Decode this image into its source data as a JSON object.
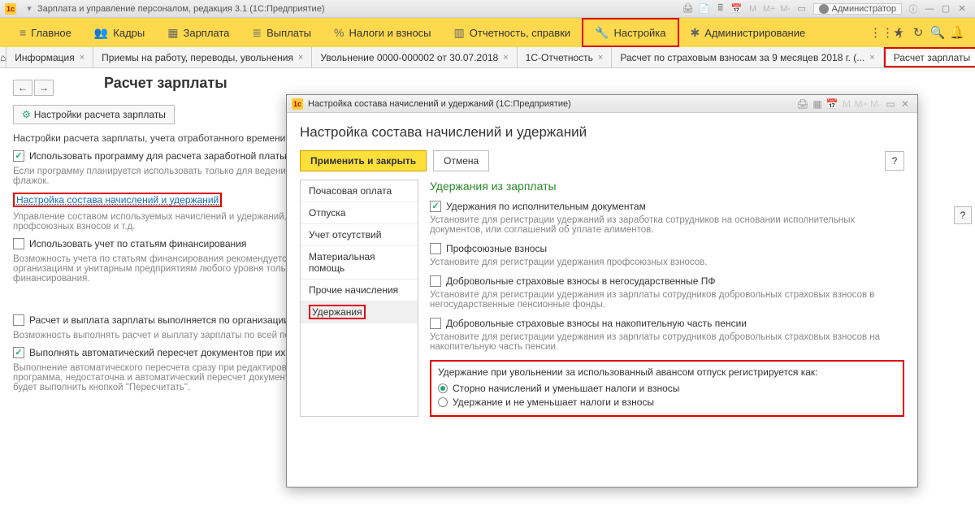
{
  "app_title": "Зарплата и управление персоналом, редакция 3.1  (1С:Предприятие)",
  "admin_user": "Администратор",
  "menu": {
    "items": [
      {
        "icon": "≡",
        "label": "Главное"
      },
      {
        "icon": "👥",
        "label": "Кадры"
      },
      {
        "icon": "▦",
        "label": "Зарплата"
      },
      {
        "icon": "≣",
        "label": "Выплаты"
      },
      {
        "icon": "%",
        "label": "Налоги и взносы"
      },
      {
        "icon": "▥",
        "label": "Отчетность, справки"
      },
      {
        "icon": "🔧",
        "label": "Настройка"
      },
      {
        "icon": "✱",
        "label": "Администрирование"
      }
    ]
  },
  "tabs": [
    {
      "label": "Информация"
    },
    {
      "label": "Приемы на работу, переводы, увольнения"
    },
    {
      "label": "Увольнение 0000-000002 от 30.07.2018"
    },
    {
      "label": "1С-Отчетность"
    },
    {
      "label": "Расчет по страховым взносам за 9 месяцев 2018 г. (..."
    },
    {
      "label": "Расчет зарплаты"
    }
  ],
  "page": {
    "title": "Расчет зарплаты",
    "settings_btn": "Настройки расчета зарплаты",
    "desc1": "Настройки расчета зарплаты, учета отработанного времени,",
    "chk_use_program": "Использовать программу для расчета заработной платы",
    "hint_use_program": "Если программу планируется использовать только для веде­ния предприятия, снимите этот флажок.",
    "link_setup": "Настройка состава начислений и удержаний",
    "hint_link": "Управление составом используемых начислений и удержан­ий, командировок, удержание профсоюзных взносов и т.д.",
    "chk_finance": "Использовать учет по статьям финансирования",
    "hint_finance": "Возможность учета по статьям финансирования рекомендуется использовать некоммерческим организациям и унитарным предприятиям любого уровня только при наличии целевого финансирования.",
    "chk_org": "Расчет и выплата зарплаты выполняется по организации",
    "hint_org": "Возможность выполнять расчет и выплату зарплаты по всей подразделениям.",
    "chk_auto": "Выполнять автоматический пересчет документов при их",
    "hint_auto": "Выполнение автоматического пересчета сразу при редактировании документа. Если производительность вашего компьютера или сервера, на котором установлена программа, недостаточна и автоматический пересчет документа выполняется с большими задержками, не используйте эту возможность. Пересчет документов можно будет выполнить кнопкой \"Пересчитать\"."
  },
  "dialog": {
    "title": "Настройка состава начислений и удержаний  (1С:Предприятие)",
    "h1": "Настройка состава начислений и удержаний",
    "apply": "Применить и закрыть",
    "cancel": "Отмена",
    "side": [
      "Почасовая оплата",
      "Отпуска",
      "Учет отсутствий",
      "Материальная помощь",
      "Прочие начисления",
      "Удержания"
    ],
    "section_title": "Удержания из зарплаты",
    "opt1": "Удержания по исполнительным документам",
    "opt1_hint": "Установите для регистрации удержаний из заработка сотрудников на основании исполнительных документов, или соглашений об уплате алиментов.",
    "opt2": "Профсоюзные взносы",
    "opt2_hint": "Установите для регистрации удержания профсоюзных взносов.",
    "opt3": "Добровольные страховые взносы в негосударственные ПФ",
    "opt3_hint": "Установите для регистрации удержания из зарплаты сотрудников добровольных страховых взносов в негосударственные пенсионные фонды.",
    "opt4": "Добровольные страховые взносы на накопительную часть пенсии",
    "opt4_hint": "Установите для регистрации удержания из зарплаты сотрудников добровольных страховых взносов на накопительную часть пенсии.",
    "radio_label": "Удержание при увольнении за использованный авансом отпуск регистрируется как:",
    "radio1": "Сторно начислений и уменьшает налоги и взносы",
    "radio2": "Удержание и не уменьшает налоги и взносы"
  }
}
